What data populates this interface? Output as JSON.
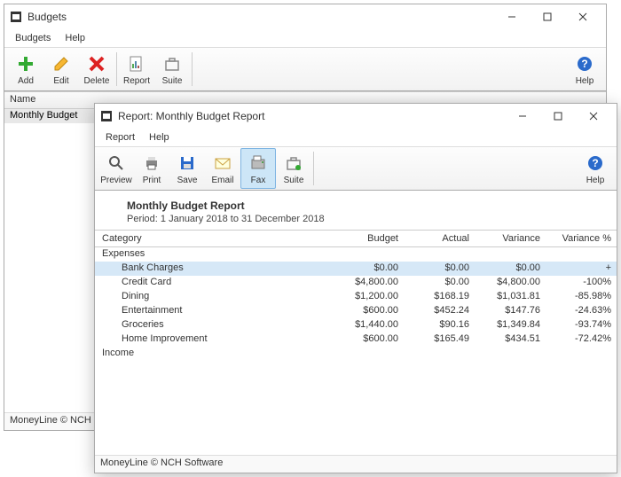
{
  "budgets_window": {
    "title": "Budgets",
    "menus": [
      "Budgets",
      "Help"
    ],
    "toolbar": [
      {
        "label": "Add"
      },
      {
        "label": "Edit"
      },
      {
        "label": "Delete"
      },
      {
        "label": "Report"
      },
      {
        "label": "Suite"
      },
      {
        "label": "Help"
      }
    ],
    "grid_header": "Name",
    "grid_rows": [
      "Monthly Budget"
    ],
    "status": "MoneyLine © NCH Software"
  },
  "report_window": {
    "title": "Report: Monthly Budget Report",
    "menus": [
      "Report",
      "Help"
    ],
    "toolbar": [
      {
        "label": "Preview"
      },
      {
        "label": "Print"
      },
      {
        "label": "Save"
      },
      {
        "label": "Email"
      },
      {
        "label": "Fax"
      },
      {
        "label": "Suite"
      },
      {
        "label": "Help"
      }
    ],
    "report_title": "Monthly Budget Report",
    "report_period": "Period: 1 January 2018 to 31 December 2018",
    "columns": [
      "Category",
      "Budget",
      "Actual",
      "Variance",
      "Variance %"
    ],
    "sections": {
      "expenses_label": "Expenses",
      "income_label": "Income"
    },
    "rows": [
      {
        "cat": "Bank Charges",
        "budget": "$0.00",
        "actual": "$0.00",
        "variance": "$0.00",
        "varpct": "+",
        "selected": true
      },
      {
        "cat": "Credit Card",
        "budget": "$4,800.00",
        "actual": "$0.00",
        "variance": "$4,800.00",
        "varpct": "-100%"
      },
      {
        "cat": "Dining",
        "budget": "$1,200.00",
        "actual": "$168.19",
        "variance": "$1,031.81",
        "varpct": "-85.98%"
      },
      {
        "cat": "Entertainment",
        "budget": "$600.00",
        "actual": "$452.24",
        "variance": "$147.76",
        "varpct": "-24.63%"
      },
      {
        "cat": "Groceries",
        "budget": "$1,440.00",
        "actual": "$90.16",
        "variance": "$1,349.84",
        "varpct": "-93.74%"
      },
      {
        "cat": "Home Improvement",
        "budget": "$600.00",
        "actual": "$165.49",
        "variance": "$434.51",
        "varpct": "-72.42%"
      }
    ],
    "status": "MoneyLine © NCH Software"
  }
}
